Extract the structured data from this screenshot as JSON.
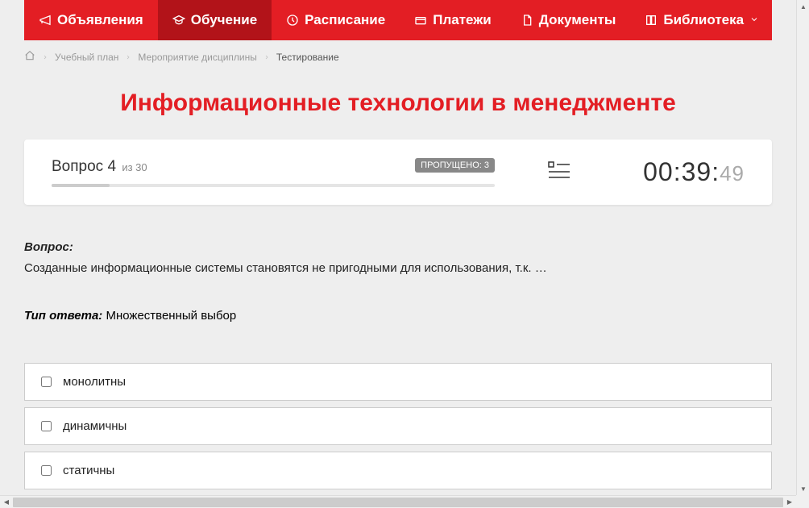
{
  "nav": {
    "items": [
      {
        "label": "Объявления"
      },
      {
        "label": "Обучение"
      },
      {
        "label": "Расписание"
      },
      {
        "label": "Платежи"
      },
      {
        "label": "Документы"
      },
      {
        "label": "Библиотека"
      }
    ]
  },
  "breadcrumb": {
    "items": [
      {
        "label": "Учебный план"
      },
      {
        "label": "Мероприятие дисциплины"
      },
      {
        "label": "Тестирование"
      }
    ]
  },
  "title": "Информационные технологии в менеджменте",
  "status": {
    "question_word": "Вопрос",
    "current": "4",
    "of_word": "из",
    "total": "30",
    "skipped_label": "ПРОПУЩЕНО: 3",
    "timer_main": "00:39:",
    "timer_sec": "49"
  },
  "question": {
    "label": "Вопрос:",
    "text": "Созданные информационные системы становятся не пригодными для использования, т.к. …"
  },
  "answer_type": {
    "label": "Тип ответа:",
    "value": "Множественный выбор"
  },
  "answers": [
    {
      "text": "монолитны"
    },
    {
      "text": "динамичны"
    },
    {
      "text": "статичны"
    }
  ]
}
